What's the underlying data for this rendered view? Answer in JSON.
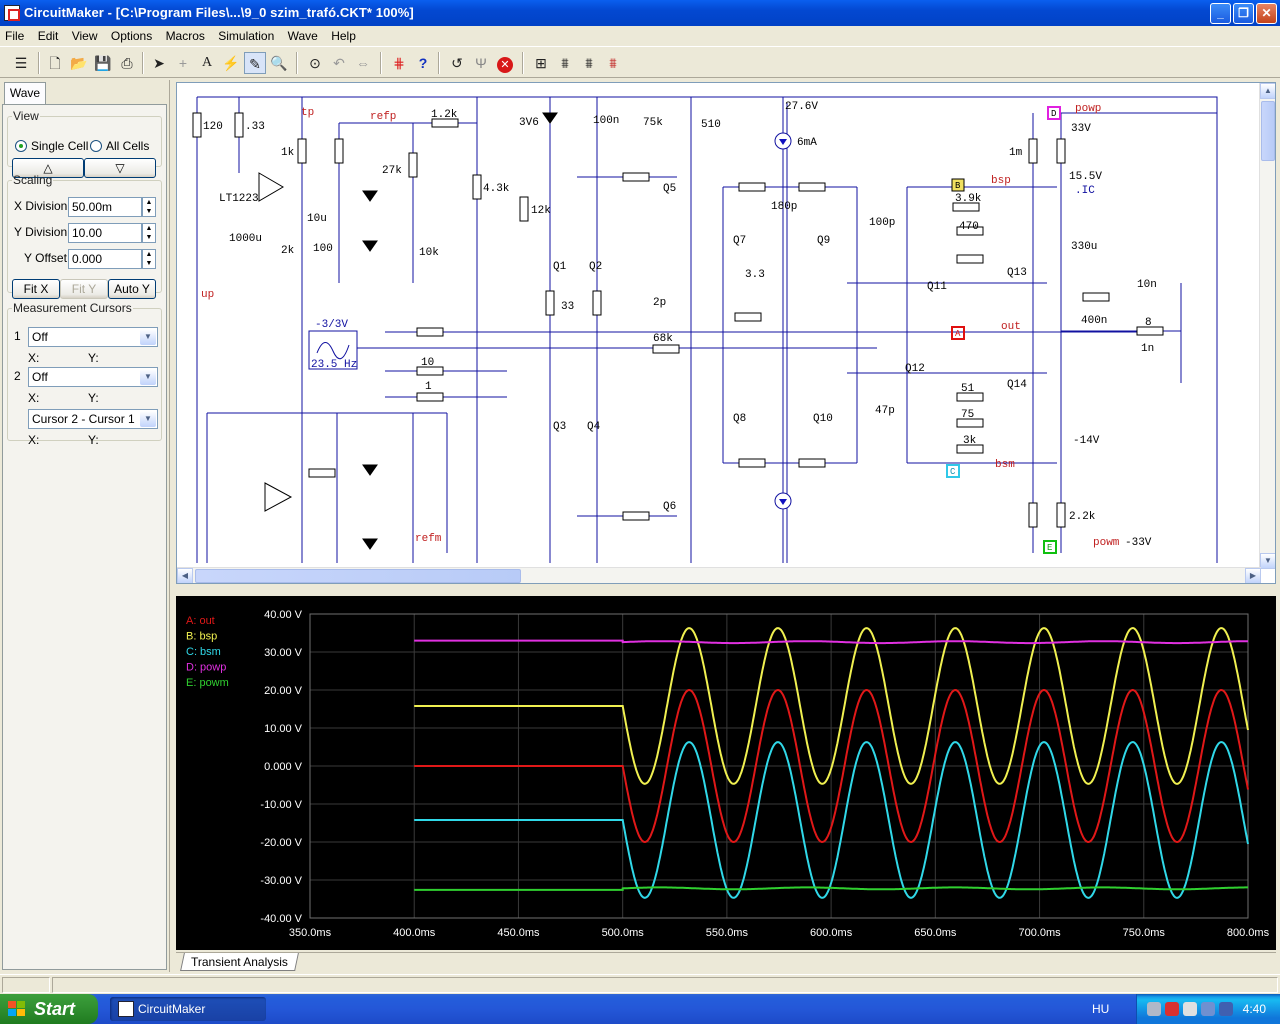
{
  "window": {
    "title": "CircuitMaker - [C:\\Program Files\\...\\9_0 szim_trafó.CKT* 100%]",
    "controls": [
      "_",
      "❐",
      "✕"
    ]
  },
  "menu": [
    "File",
    "Edit",
    "View",
    "Options",
    "Macros",
    "Simulation",
    "Wave",
    "Help"
  ],
  "toolbar": {
    "icons": [
      "new-file-icon",
      "open-folder-icon",
      "save-icon",
      "print-icon",
      "arrow-tool-icon",
      "wire-tool-icon",
      "text-tool-icon",
      "probe-tool-icon",
      "zoom-icon",
      "search-icon",
      "rotate-icon",
      "mirror-icon",
      "netlist-icon",
      "help-icon",
      "undo-icon",
      "trace-icon",
      "stop-icon",
      "waveform-1-icon",
      "waveform-2-icon",
      "waveform-3-icon",
      "waveform-4-icon"
    ]
  },
  "left_panel": {
    "tab": "Wave",
    "view": {
      "legend": "View",
      "single_cell": "Single Cell",
      "all_cells": "All Cells",
      "selected": "Single Cell"
    },
    "scaling": {
      "legend": "Scaling",
      "x_division_label": "X Division",
      "x_division": "50.00m",
      "y_division_label": "Y Division",
      "y_division": "10.00",
      "y_offset_label": "Y Offset",
      "y_offset": "0.000",
      "fit_x": "Fit X",
      "fit_y": "Fit Y",
      "auto_y": "Auto Y"
    },
    "cursors": {
      "legend": "Measurement Cursors",
      "c1_num": "1",
      "c1_value": "Off",
      "c2_num": "2",
      "c2_value": "Off",
      "x_label": "X:",
      "y_label": "Y:",
      "diff_value": "Cursor 2 - Cursor 1"
    }
  },
  "schematic": {
    "labels": [
      "tp",
      "refp",
      "up",
      "LT1223",
      "1.2k",
      "1k",
      ".33",
      "120",
      "27k",
      "10u",
      "1000u",
      "2k",
      "100",
      "10k",
      "4.3k",
      "3V6",
      "100n",
      "75k",
      "510",
      "12k",
      "Q1",
      "Q2",
      "Q3",
      "Q4",
      "Q5",
      "Q6",
      "33",
      "2p",
      "68k",
      "10",
      "1",
      "-3/3V",
      "23.5 Hz",
      "27.6V",
      "6mA",
      "180p",
      "Q7",
      "Q8",
      "Q9",
      "Q10",
      "Q11",
      "Q12",
      "Q13",
      "Q14",
      "3.3",
      "100p",
      "47p",
      "3.9k",
      "470",
      "51",
      "75",
      "3k",
      "bsp",
      "bsm",
      "powp",
      "powm",
      "33V",
      "15.5V",
      ".IC",
      "330u",
      "10n",
      "400n",
      "8",
      "1n",
      "out",
      "-14V",
      "2.2k",
      "-33V",
      "1m",
      "refm"
    ],
    "nodes": [
      "A",
      "B",
      "C",
      "D",
      "E"
    ]
  },
  "chart_data": {
    "type": "line",
    "title": "",
    "xlabel": "",
    "ylabel": "",
    "xlim": [
      350,
      800
    ],
    "ylim": [
      -40,
      40
    ],
    "x_ticks": [
      "350.0ms",
      "400.0ms",
      "450.0ms",
      "500.0ms",
      "550.0ms",
      "600.0ms",
      "650.0ms",
      "700.0ms",
      "750.0ms",
      "800.0ms"
    ],
    "y_ticks": [
      "40.00 V",
      "30.00 V",
      "20.00 V",
      "10.00 V",
      "0.000 V",
      "-10.00 V",
      "-20.00 V",
      "-30.00 V",
      "-40.00 V"
    ],
    "grid": true,
    "legend_position": "top-left",
    "sine": {
      "start_ms": 500,
      "frequency_hz": 23.5
    },
    "series": [
      {
        "name": "A: out",
        "color": "#E01818",
        "before": 0,
        "offset": 0,
        "amplitude": 20
      },
      {
        "name": "B: bsp",
        "color": "#F0F050",
        "before": 15.8,
        "offset": 15.8,
        "amplitude": 20.5
      },
      {
        "name": "C: bsm",
        "color": "#30D8E8",
        "before": -14.2,
        "offset": -14.2,
        "amplitude": 20.5
      },
      {
        "name": "D: powp",
        "color": "#E030E0",
        "before": 33,
        "offset": 32.6,
        "amplitude": 0.5
      },
      {
        "name": "E: powm",
        "color": "#30D030",
        "before": -32.6,
        "offset": -32.2,
        "amplitude": 0.5
      }
    ]
  },
  "bottom_tab": "Transient Analysis",
  "taskbar": {
    "start": "Start",
    "task": "CircuitMaker",
    "lang": "HU",
    "clock": "4:40"
  }
}
